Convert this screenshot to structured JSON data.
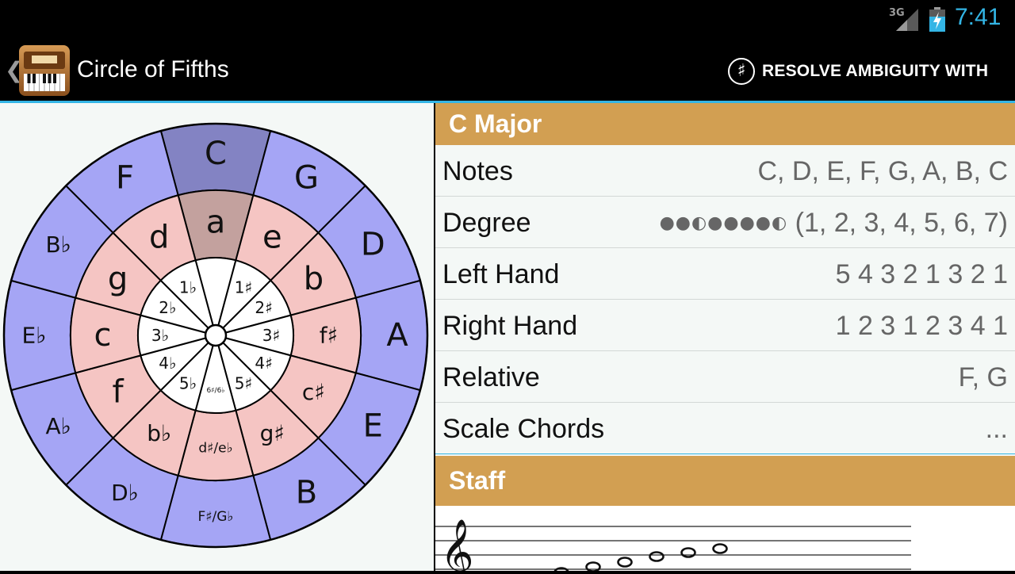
{
  "status_bar": {
    "network": "3G",
    "time": "7:41"
  },
  "action_bar": {
    "title": "Circle of Fifths",
    "action_label": "RESOLVE AMBIGUITY WITH",
    "action_icon": "sharp-icon"
  },
  "circle": {
    "selected_index": 0,
    "outer_keys": [
      "C",
      "G",
      "D",
      "A",
      "E",
      "B",
      "F♯/G♭",
      "D♭",
      "A♭",
      "E♭",
      "B♭",
      "F"
    ],
    "inner_keys": [
      "a",
      "e",
      "b",
      "f♯",
      "c♯",
      "g♯",
      "d♯/e♭",
      "b♭",
      "f",
      "c",
      "g",
      "d"
    ],
    "signatures": [
      "",
      "1♯",
      "2♯",
      "3♯",
      "4♯",
      "5♯",
      "6♯/6♭",
      "5♭",
      "4♭",
      "3♭",
      "2♭",
      "1♭"
    ],
    "colors": {
      "outer": "#a5a5f5",
      "outer_selected": "#8383c3",
      "middle": "#f5c5c3",
      "middle_selected": "#c3a19e",
      "inner": "#ffffff"
    }
  },
  "details": {
    "key_header": "C Major",
    "rows": [
      {
        "label": "Notes",
        "value": "C, D, E, F, G, A, B, C"
      },
      {
        "label": "Degree",
        "dots": "●●◐●●●●◐",
        "value": "(1, 2, 3, 4, 5, 6, 7)"
      },
      {
        "label": "Left Hand",
        "value": "5 4 3 2 1 3 2 1"
      },
      {
        "label": "Right Hand",
        "value": "1 2 3 1 2 3 4 1"
      },
      {
        "label": "Relative",
        "value": "F, G"
      },
      {
        "label": "Scale Chords",
        "value": "..."
      }
    ],
    "staff_header": "Staff"
  }
}
